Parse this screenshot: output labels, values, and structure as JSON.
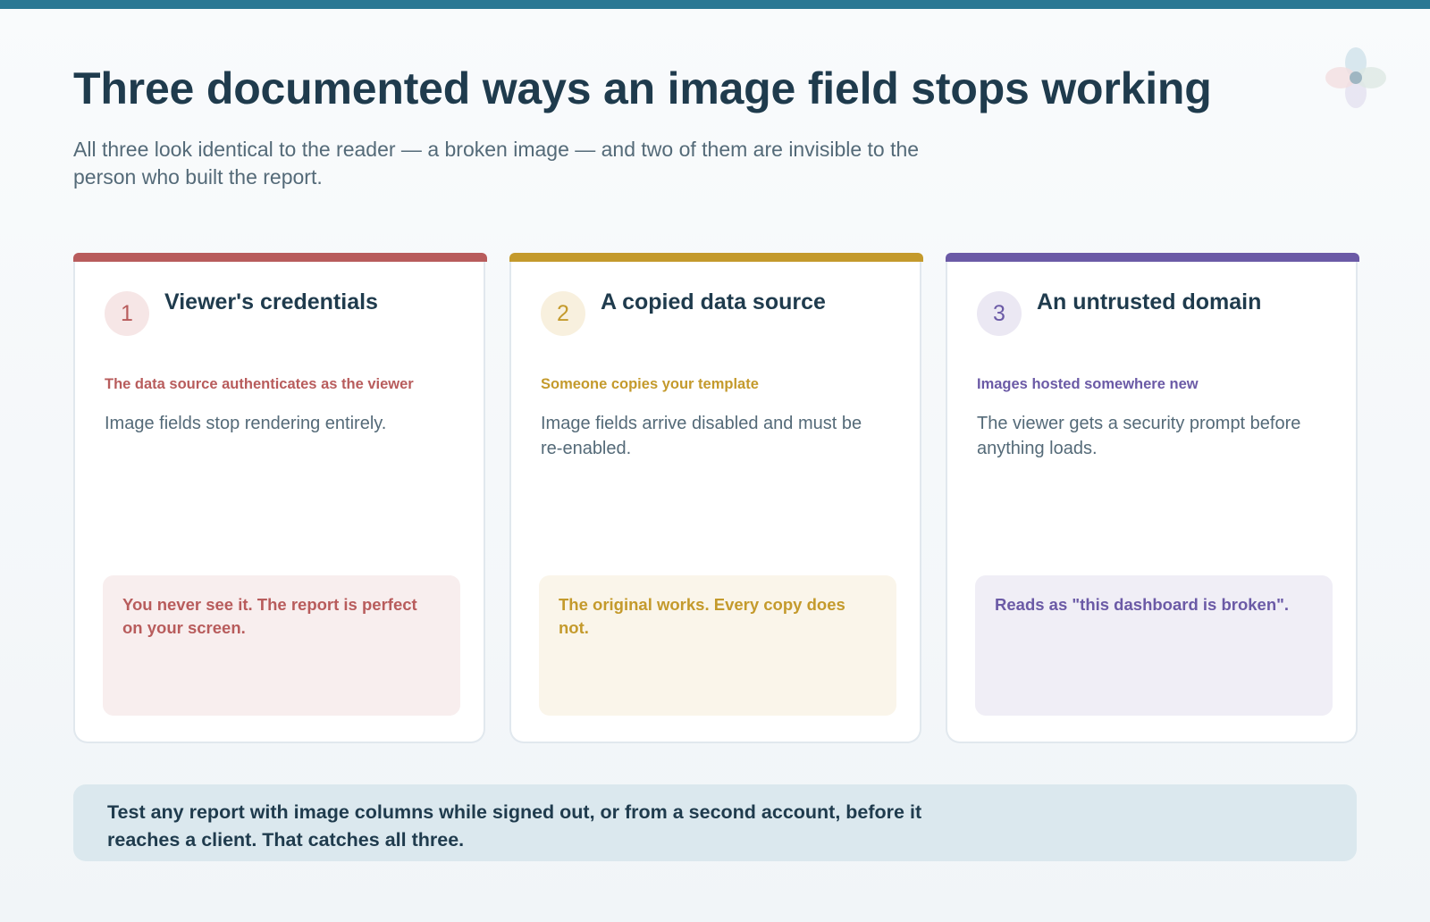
{
  "page": {
    "title": "Three documented ways an image field stops working",
    "subtitle": "All three look identical to the reader — a broken image — and two of them are invisible to the person who built the report."
  },
  "cards": [
    {
      "number": "1",
      "title": "Viewer's credentials",
      "subtitle": "The data source authenticates as the viewer",
      "body": "Image fields stop rendering entirely.",
      "note": "You never see it. The report is perfect on your screen.",
      "accent": "#b85c5c",
      "tint": "#f8eeee"
    },
    {
      "number": "2",
      "title": "A copied data source",
      "subtitle": "Someone copies your template",
      "body": "Image fields arrive disabled and must be re-enabled.",
      "note": "The original works. Every copy does not.",
      "accent": "#c49a2c",
      "tint": "#faf5ea"
    },
    {
      "number": "3",
      "title": "An untrusted domain",
      "subtitle": "Images hosted somewhere new",
      "body": "The viewer gets a security prompt before anything loads.",
      "note": "Reads as \"this dashboard is broken\".",
      "accent": "#6b5aa6",
      "tint": "#f0eef6"
    }
  ],
  "footer": {
    "text": "Test any report with image columns while signed out, or from a second account, before it reaches a client. That catches all three."
  },
  "colors": {
    "top_bar": "#2b7894",
    "title": "#1f3b4d",
    "footer_bg": "#dbe8ee"
  }
}
